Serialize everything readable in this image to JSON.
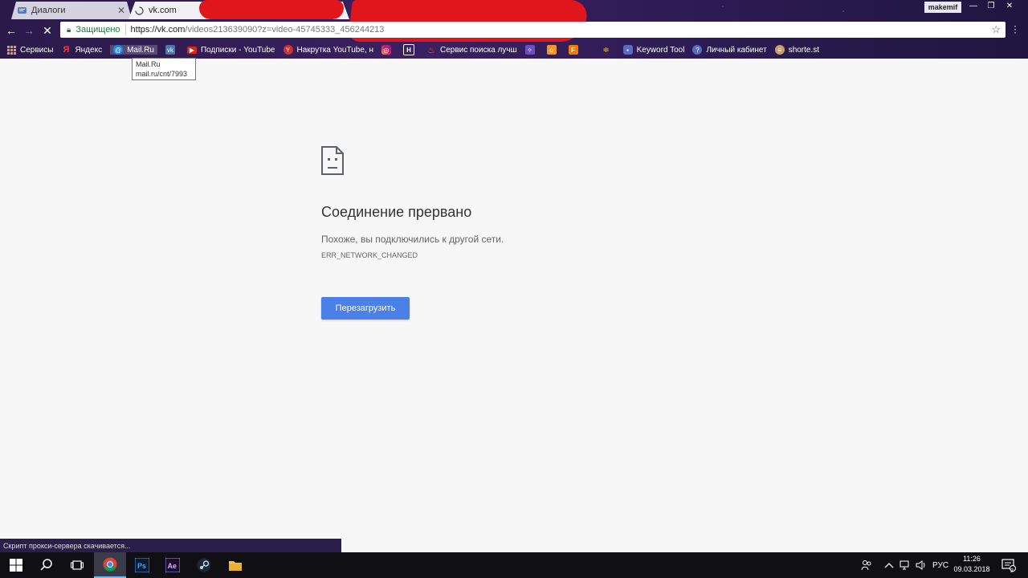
{
  "tabs": [
    {
      "title": "Диалоги",
      "active": false
    },
    {
      "title": "vk.com",
      "active": true
    }
  ],
  "window": {
    "user": "makemif"
  },
  "omnibox": {
    "secure_label": "Защищено",
    "url_host": "https://vk.com",
    "url_rest": "/videos213639090?z=video-45745333_456244213"
  },
  "bookmarks": [
    {
      "label": "Сервисы",
      "icon": "apps-grid-icon"
    },
    {
      "label": "Яндекс",
      "icon": "yandex-icon"
    },
    {
      "label": "Mail.Ru",
      "icon": "mailru-icon"
    },
    {
      "label": "",
      "icon": "vk-icon"
    },
    {
      "label": "Подписки - YouTube",
      "icon": "youtube-icon"
    },
    {
      "label": "Накрутка YouTube, н",
      "icon": "y-icon"
    },
    {
      "label": "",
      "icon": "instagram-icon"
    },
    {
      "label": "",
      "icon": "h-icon"
    },
    {
      "label": "Сервис поиска лучш",
      "icon": "fire-icon"
    },
    {
      "label": "",
      "icon": "butterfly-icon"
    },
    {
      "label": "",
      "icon": "odnoklassniki-icon"
    },
    {
      "label": "",
      "icon": "f-icon"
    },
    {
      "label": "",
      "icon": "lamp-icon"
    },
    {
      "label": "Keyword Tool",
      "icon": "keyword-icon"
    },
    {
      "label": "Личный кабинет",
      "icon": "question-icon"
    },
    {
      "label": "shorte.st",
      "icon": "shortest-icon"
    }
  ],
  "tooltip": {
    "line1": "Mail.Ru",
    "line2": "mail.ru/cnt/7993"
  },
  "error": {
    "title": "Соединение прервано",
    "message": "Похоже, вы подключились к другой сети.",
    "code": "ERR_NETWORK_CHANGED",
    "reload_label": "Перезагрузить"
  },
  "status_bar": "Скрипт прокси-сервера скачивается...",
  "taskbar": {
    "apps": [
      "windows-start-icon",
      "search-icon",
      "task-view-icon",
      "chrome-icon",
      "photoshop-icon",
      "after-effects-icon",
      "steam-icon",
      "file-explorer-icon"
    ],
    "language": "РУС",
    "time": "11:26",
    "date": "09.03.2018",
    "notifications": "2"
  },
  "colors": {
    "accent": "#4a80e8",
    "secure": "#188038",
    "redaction": "#e0161c"
  }
}
